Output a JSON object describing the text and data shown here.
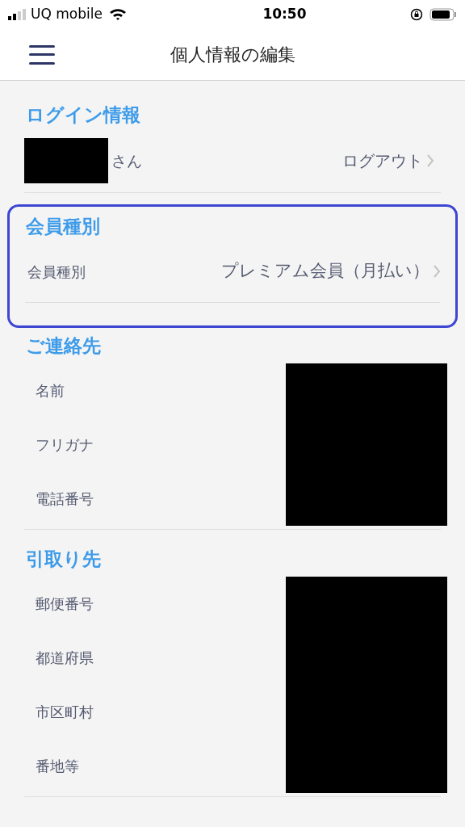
{
  "status_bar": {
    "carrier": "UQ mobile",
    "time": "10:50"
  },
  "nav": {
    "title": "個人情報の編集"
  },
  "sections": [
    {
      "title": "ログイン情報",
      "highlighted": false,
      "rows": [
        {
          "kind": "user",
          "suffix": "さん",
          "action": "ログアウト",
          "redacted": true
        }
      ]
    },
    {
      "title": "会員種別",
      "highlighted": true,
      "rows": [
        {
          "kind": "link",
          "label": "会員種別",
          "value": "プレミアム会員（月払い）"
        }
      ]
    },
    {
      "title": "ご連絡先",
      "highlighted": false,
      "rows": [
        {
          "kind": "field",
          "label": "名前",
          "redacted": true
        },
        {
          "kind": "field",
          "label": "フリガナ",
          "redacted": true
        },
        {
          "kind": "field",
          "label": "電話番号",
          "redacted": true
        }
      ]
    },
    {
      "title": "引取り先",
      "highlighted": false,
      "rows": [
        {
          "kind": "field",
          "label": "郵便番号",
          "redacted": true
        },
        {
          "kind": "field",
          "label": "都道府県",
          "redacted": true
        },
        {
          "kind": "field",
          "label": "市区町村",
          "redacted": true
        },
        {
          "kind": "field",
          "label": "番地等",
          "redacted": true
        }
      ]
    }
  ]
}
